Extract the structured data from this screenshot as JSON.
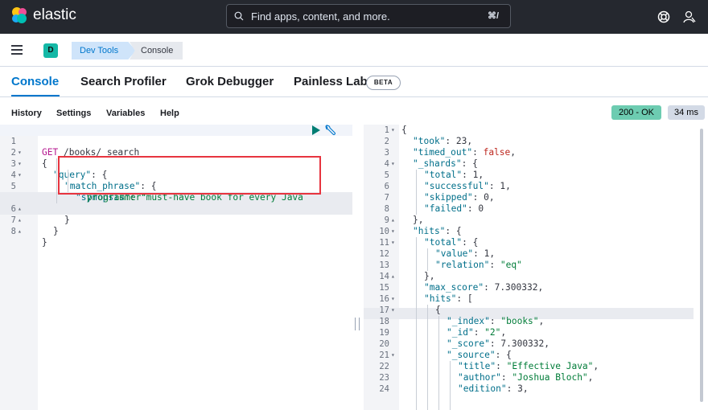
{
  "header": {
    "brand": "elastic",
    "search_placeholder": "Find apps, content, and more.",
    "search_shortcut": "⌘/"
  },
  "breadcrumb": {
    "avatar": "D",
    "items": [
      "Dev Tools",
      "Console"
    ]
  },
  "tabs": [
    {
      "label": "Console",
      "active": true
    },
    {
      "label": "Search Profiler"
    },
    {
      "label": "Grok Debugger"
    },
    {
      "label": "Painless Lab"
    }
  ],
  "beta_badge": "BETA",
  "toolbar": {
    "menu": [
      "History",
      "Settings",
      "Variables",
      "Help"
    ],
    "status": "200 - OK",
    "time": "34 ms"
  },
  "request_lines": [
    "1",
    "2",
    "3",
    "4",
    "5",
    "6",
    "7",
    "8"
  ],
  "response_lines": [
    "1",
    "2",
    "3",
    "4",
    "5",
    "6",
    "7",
    "8",
    "9",
    "10",
    "11",
    "12",
    "13",
    "14",
    "15",
    "16",
    "17",
    "18",
    "19",
    "20",
    "21",
    "22",
    "23",
    "24"
  ],
  "request": {
    "method": "GET",
    "path": "/books/_search",
    "query_key": "\"query\"",
    "match_key": "\"match_phrase\"",
    "field_key": "\"synopsis\"",
    "field_value_1": "\"must-have book for every Java",
    "field_value_2": "programmer\""
  },
  "response": {
    "took_key": "\"took\"",
    "took_val": "23",
    "timed_out_key": "\"timed_out\"",
    "timed_out_val": "false",
    "shards_key": "\"_shards\"",
    "total_key": "\"total\"",
    "total_val": "1",
    "successful_key": "\"successful\"",
    "successful_val": "1",
    "skipped_key": "\"skipped\"",
    "skipped_val": "0",
    "failed_key": "\"failed\"",
    "failed_val": "0",
    "hits_key": "\"hits\"",
    "value_key": "\"value\"",
    "value_val": "1",
    "relation_key": "\"relation\"",
    "relation_val": "\"eq\"",
    "max_score_key": "\"max_score\"",
    "max_score_val": "7.300332",
    "index_key": "\"_index\"",
    "index_val": "\"books\"",
    "id_key": "\"_id\"",
    "id_val": "\"2\"",
    "score_key": "\"_score\"",
    "score_val": "7.300332",
    "source_key": "\"_source\"",
    "title_key": "\"title\"",
    "title_val": "\"Effective Java\"",
    "author_key": "\"author\"",
    "author_val": "\"Joshua Bloch\"",
    "edition_key": "\"edition\"",
    "edition_val": "3"
  },
  "colors": {
    "topbar": "#25282f",
    "accent": "#0077cc",
    "status_ok": "#6dccb1",
    "highlight_box": "#e7343f"
  }
}
